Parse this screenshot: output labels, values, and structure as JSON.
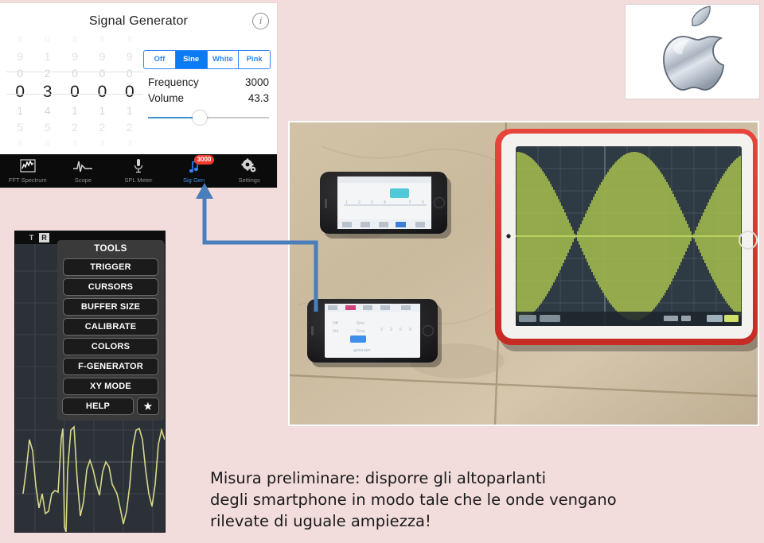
{
  "background_color": "#f2dcdc",
  "siggen": {
    "title": "Signal Generator",
    "info_icon": "info-circle-icon",
    "picker": {
      "selected": [
        "0",
        "3",
        "0",
        "0",
        "0"
      ],
      "columns": [
        {
          "above": [
            "8",
            "9",
            "0"
          ],
          "selected": "0",
          "below": [
            "1",
            "5",
            "6"
          ]
        },
        {
          "above": [
            "0",
            "1",
            "2"
          ],
          "selected": "3",
          "below": [
            "4",
            "5",
            "6"
          ]
        },
        {
          "above": [
            "8",
            "9",
            "0"
          ],
          "selected": "0",
          "below": [
            "1",
            "2",
            "3"
          ]
        },
        {
          "above": [
            "8",
            "9",
            "0"
          ],
          "selected": "0",
          "below": [
            "1",
            "2",
            "3"
          ]
        },
        {
          "above": [
            "8",
            "9",
            "0"
          ],
          "selected": "0",
          "below": [
            "1",
            "2",
            "3"
          ]
        }
      ]
    },
    "waveform_options": [
      "Off",
      "Sine",
      "White",
      "Pink"
    ],
    "waveform_selected": "Sine",
    "frequency_label": "Frequency",
    "frequency_value": "3000",
    "volume_label": "Volume",
    "volume_value": "43.3",
    "volume_slider_percent": 43,
    "accent_color": "#0a7bf3",
    "tabs": [
      {
        "label": "FFT Spectrum",
        "icon": "fft-spectrum-icon",
        "active": false
      },
      {
        "label": "Scope",
        "icon": "scope-waveform-icon",
        "active": false
      },
      {
        "label": "SPL Meter",
        "icon": "microphone-icon",
        "active": false
      },
      {
        "label": "Sig Gen",
        "icon": "music-note-icon",
        "active": true,
        "badge": "3000"
      },
      {
        "label": "Settings",
        "icon": "gear-icon",
        "active": false
      }
    ]
  },
  "apple_logo": {
    "name": "apple-logo"
  },
  "scope_panel": {
    "top_buttons": [
      "T",
      "R"
    ],
    "tools_title": "TOOLS",
    "tools": [
      "TRIGGER",
      "CURSORS",
      "BUFFER SIZE",
      "CALIBRATE",
      "COLORS",
      "F-GENERATOR",
      "XY MODE"
    ],
    "help_label": "HELP",
    "star_label": "★",
    "waveform_color": "#d8d88a",
    "grid_color": "#3b4349",
    "background_color": "#2b3137"
  },
  "photo": {
    "name": "photo-speakers-setup",
    "description_items": [
      "iphone-top",
      "iphone-bottom",
      "ipad-red-case-oscilloscope"
    ],
    "ipad_waveform_color": "#b5cf4e",
    "ipad_screen_color": "#2f3b44",
    "ipad_case_color": "#e0362f"
  },
  "connector": {
    "name": "callout-arrow",
    "color": "#4a7ebb"
  },
  "caption": {
    "line1": "Misura preliminare: disporre gli altoparlanti",
    "line2": "degli smartphone  in modo tale che le onde vengano",
    "line3": "rilevate di uguale ampiezza!"
  }
}
